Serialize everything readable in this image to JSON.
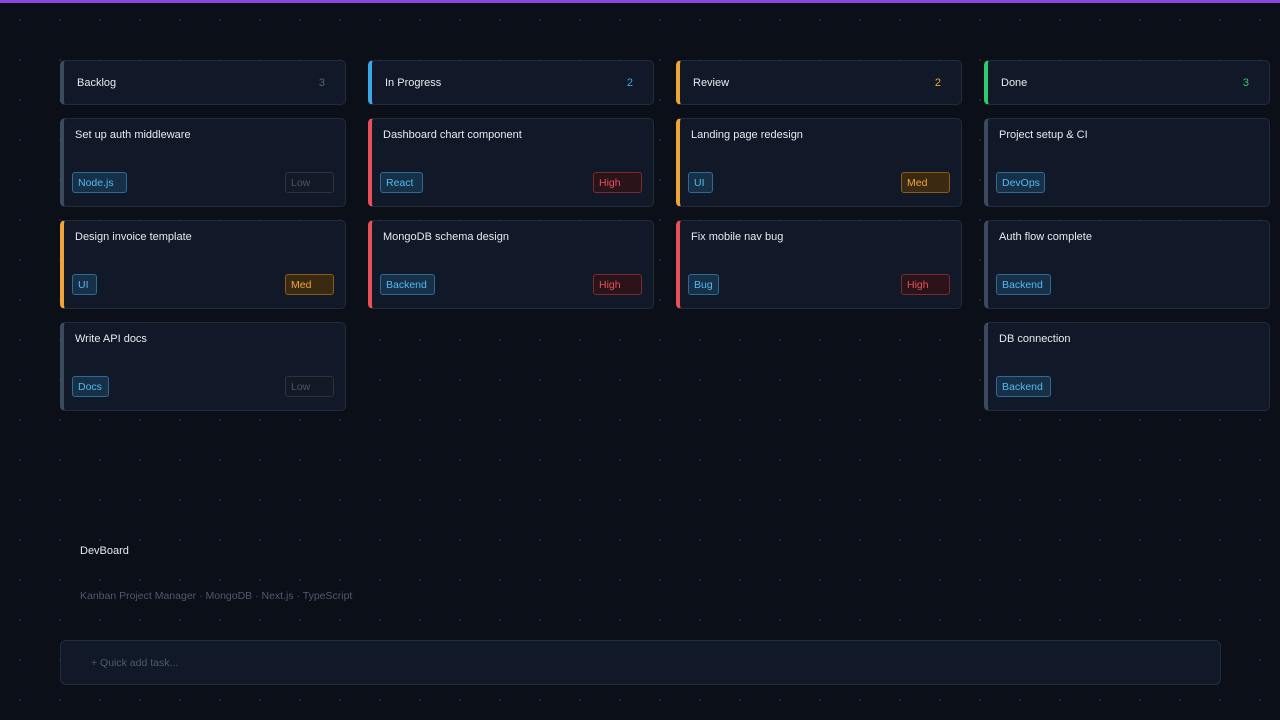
{
  "brand": {
    "name": "DevBoard",
    "subtitle": "Kanban Project Manager · MongoDB · Next.js · TypeScript"
  },
  "quick_add": {
    "placeholder": "+ Quick add task..."
  },
  "colors": {
    "accent": "#8e44e0",
    "backlog": "#3c4a60",
    "in_progress": "#3ea7e8",
    "review": "#f0a53a",
    "done": "#2ecc6f",
    "high": "#e8505a",
    "med": "#f0a53a",
    "low": "#4b5566",
    "tag": "#55b9f0"
  },
  "columns": [
    {
      "title": "Backlog",
      "count": "3",
      "color": "#3c4a60",
      "cards": [
        {
          "title": "Set up auth middleware",
          "tag": "Node.js",
          "priority": "Low",
          "level": "low",
          "bar": "#3c4a60"
        },
        {
          "title": "Design invoice template",
          "tag": "UI",
          "priority": "Med",
          "level": "med",
          "bar": "#f0a53a"
        },
        {
          "title": "Write API docs",
          "tag": "Docs",
          "priority": "Low",
          "level": "low",
          "bar": "#3c4a60"
        }
      ]
    },
    {
      "title": "In Progress",
      "count": "2",
      "color": "#3ea7e8",
      "cards": [
        {
          "title": "Dashboard chart component",
          "tag": "React",
          "priority": "High",
          "level": "high",
          "bar": "#e8505a"
        },
        {
          "title": "MongoDB schema design",
          "tag": "Backend",
          "priority": "High",
          "level": "high",
          "bar": "#e8505a"
        }
      ]
    },
    {
      "title": "Review",
      "count": "2",
      "color": "#f0a53a",
      "cards": [
        {
          "title": "Landing page redesign",
          "tag": "UI",
          "priority": "Med",
          "level": "med",
          "bar": "#f0a53a"
        },
        {
          "title": "Fix mobile nav bug",
          "tag": "Bug",
          "priority": "High",
          "level": "high",
          "bar": "#e8505a"
        }
      ]
    },
    {
      "title": "Done",
      "count": "3",
      "color": "#2ecc6f",
      "cards": [
        {
          "title": "Project setup & CI",
          "tag": "DevOps",
          "priority": "",
          "level": "",
          "bar": "#3c4a60"
        },
        {
          "title": "Auth flow complete",
          "tag": "Backend",
          "priority": "",
          "level": "",
          "bar": "#3c4a60"
        },
        {
          "title": "DB connection",
          "tag": "Backend",
          "priority": "",
          "level": "",
          "bar": "#3c4a60"
        }
      ]
    }
  ]
}
